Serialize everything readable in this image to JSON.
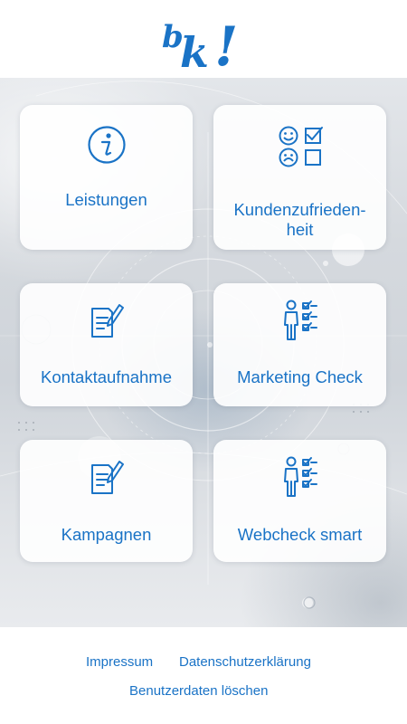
{
  "brand": {
    "logo_text": "bk!",
    "accent_color": "#1a73c6"
  },
  "tiles": [
    {
      "label": "Leistungen",
      "icon": "info-icon"
    },
    {
      "label": "Kundenzufrieden-\nheit",
      "icon": "satisfaction-checklist-icon"
    },
    {
      "label": "Kontaktaufnahme",
      "icon": "document-edit-icon"
    },
    {
      "label": "Marketing Check",
      "icon": "person-checklist-icon"
    },
    {
      "label": "Kampagnen",
      "icon": "document-edit-icon"
    },
    {
      "label": "Webcheck smart",
      "icon": "person-checklist-icon"
    }
  ],
  "footer": {
    "impressum": "Impressum",
    "datenschutz": "Datenschutzerklärung",
    "benutzerdaten": "Benutzerdaten löschen"
  }
}
